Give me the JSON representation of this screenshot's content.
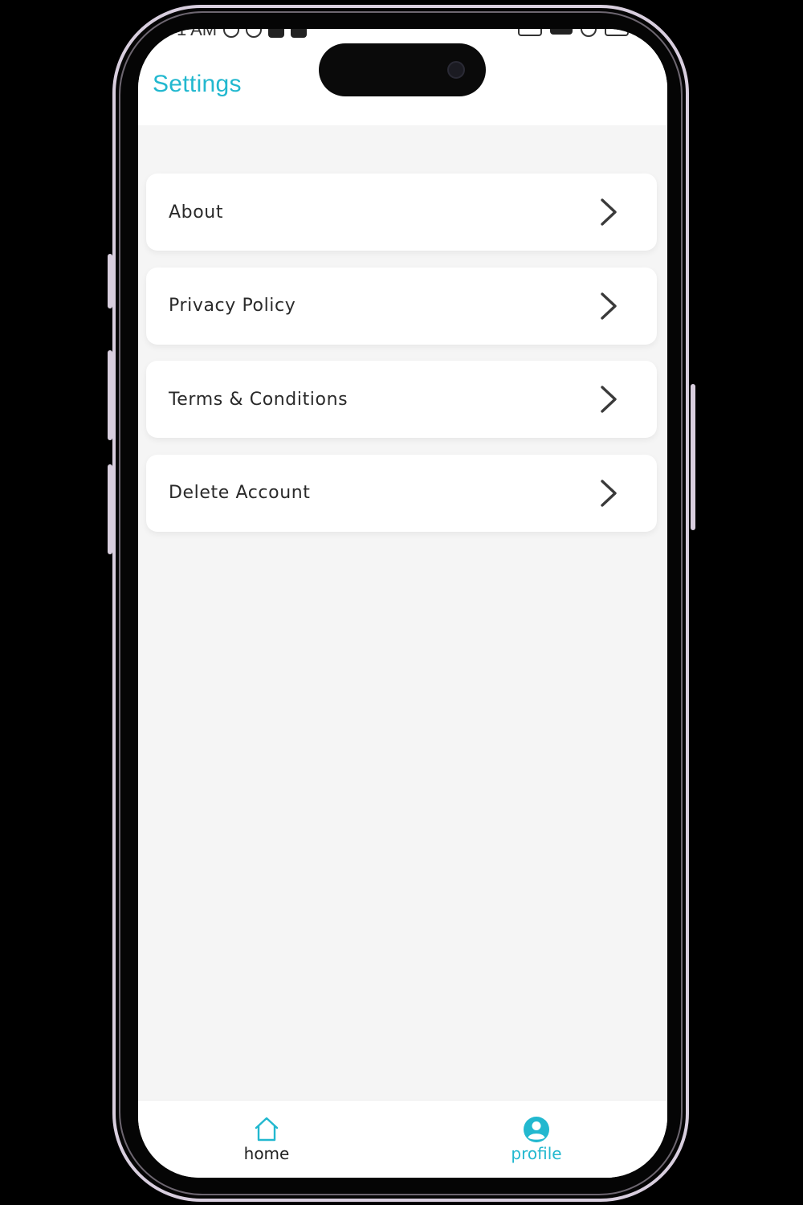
{
  "status_bar": {
    "time": "1 AM"
  },
  "header": {
    "title": "Settings"
  },
  "menu": {
    "items": [
      {
        "label": "About"
      },
      {
        "label": "Privacy Policy"
      },
      {
        "label": "Terms & Conditions"
      },
      {
        "label": "Delete Account"
      }
    ],
    "chevron_icon": "chevron-right-icon"
  },
  "bottom_nav": {
    "items": [
      {
        "label": "home",
        "icon": "home-icon",
        "active": false
      },
      {
        "label": "profile",
        "icon": "profile-icon",
        "active": true
      }
    ]
  },
  "colors": {
    "accent": "#22b8cf",
    "background": "#f5f5f5",
    "card": "#ffffff",
    "text": "#2a2a2a"
  }
}
